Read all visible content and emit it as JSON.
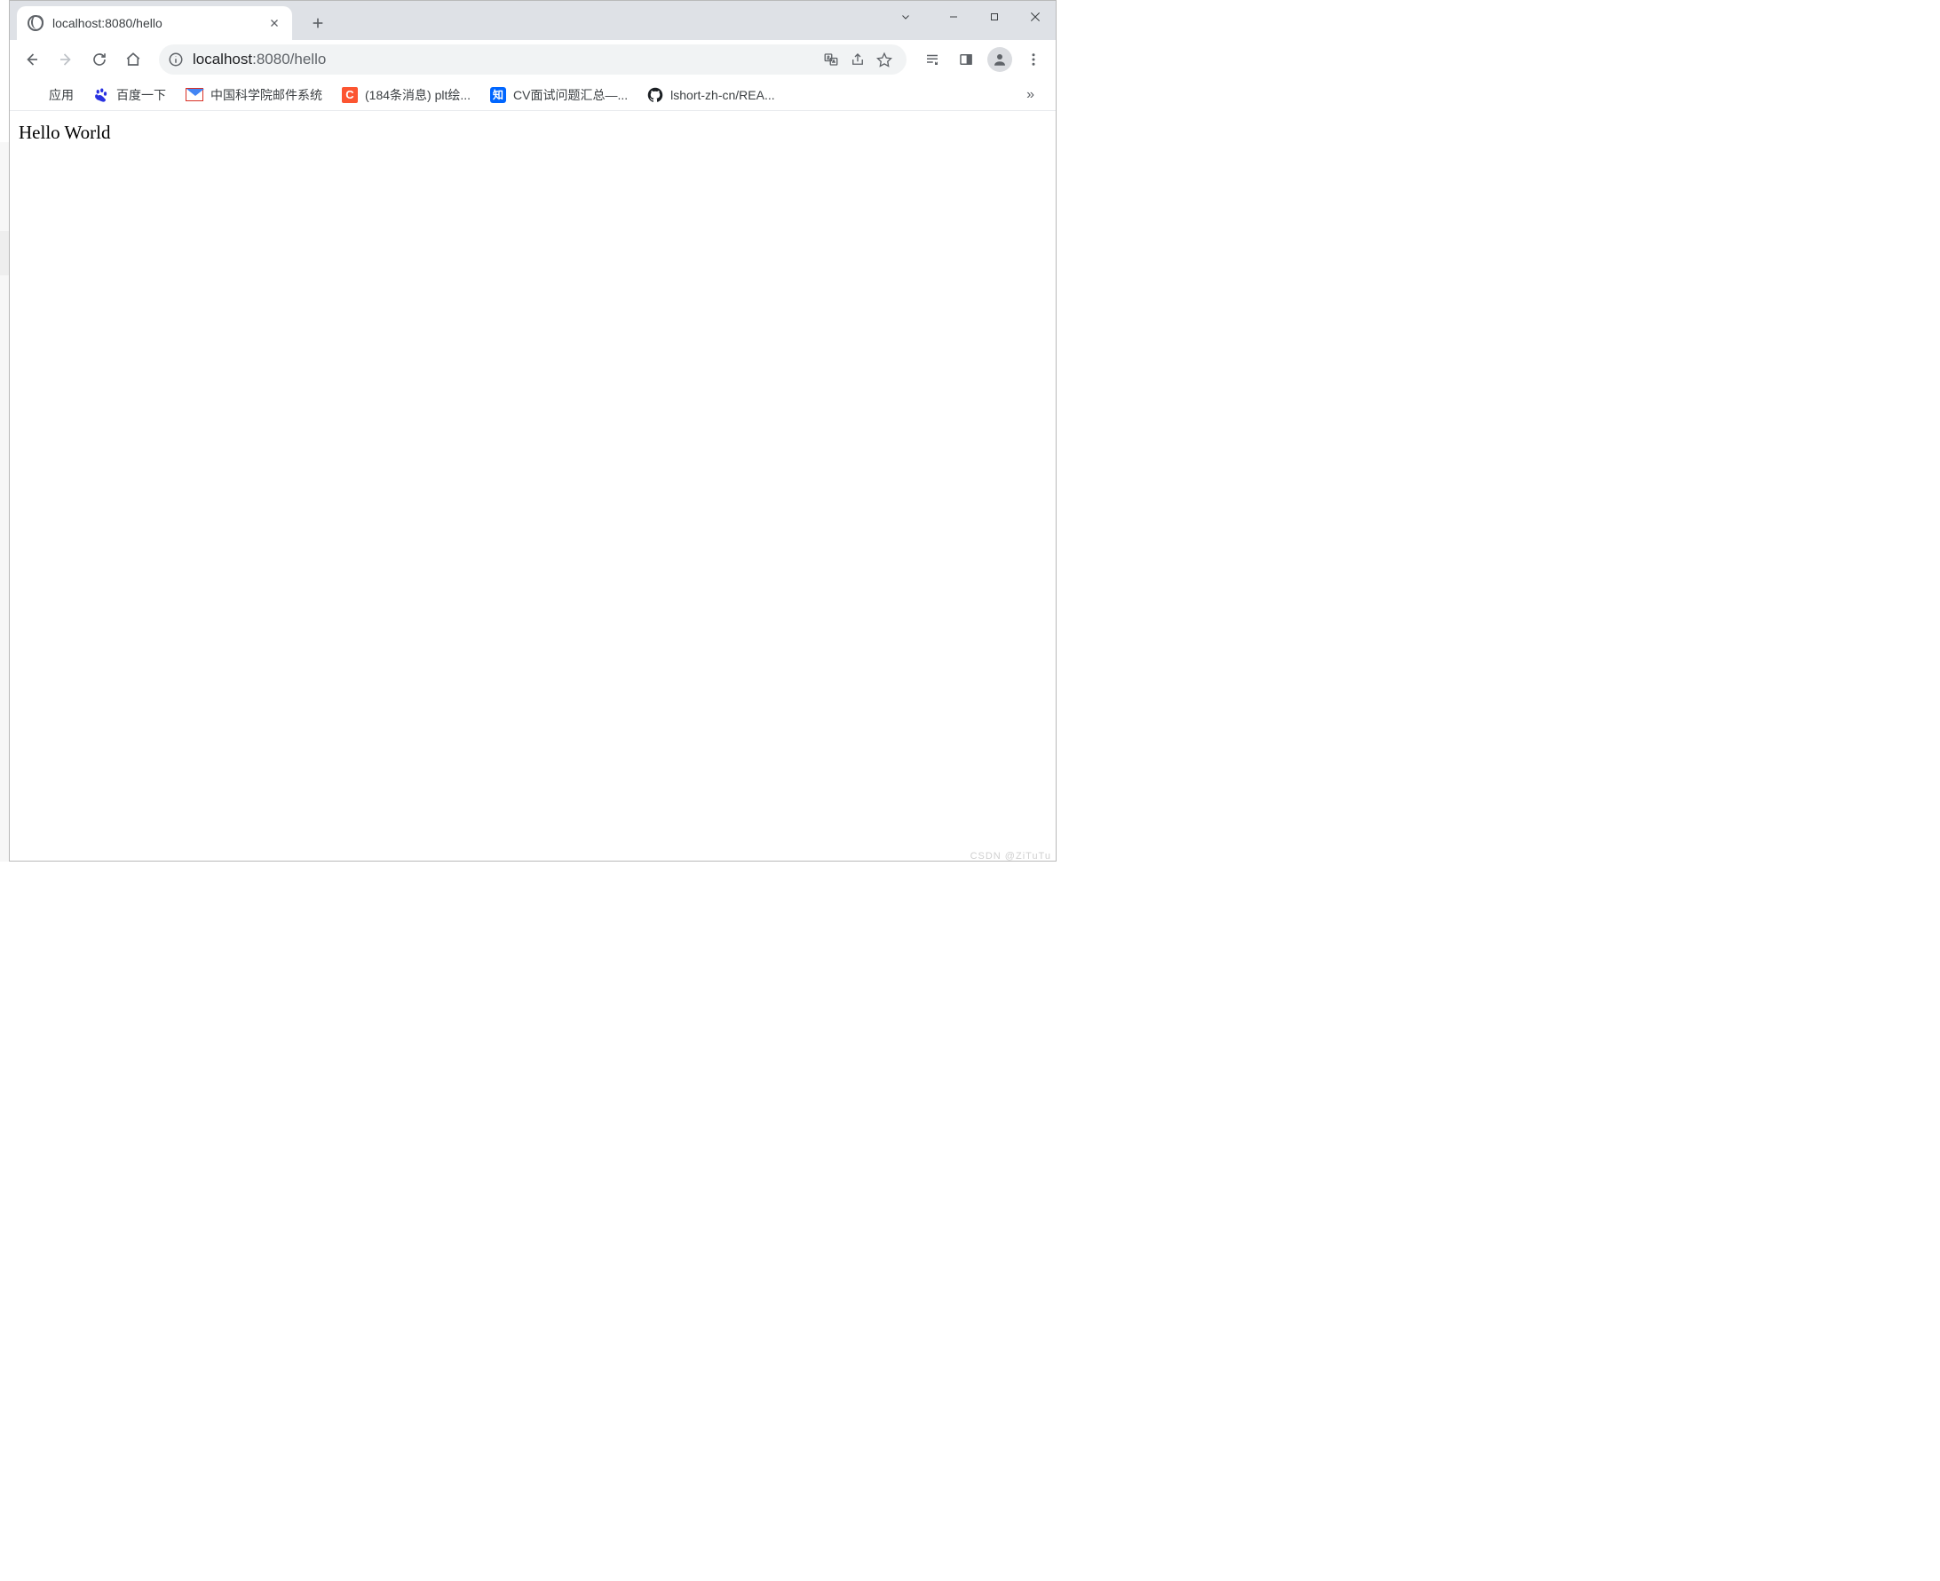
{
  "tab": {
    "title": "localhost:8080/hello"
  },
  "address": {
    "host": "localhost",
    "port": ":8080",
    "path": "/hello"
  },
  "bookmarks": {
    "items": [
      {
        "label": "应用",
        "icon": "apps"
      },
      {
        "label": "百度一下",
        "icon": "baidu"
      },
      {
        "label": "中国科学院邮件系统",
        "icon": "mail"
      },
      {
        "label": "(184条消息) plt绘...",
        "icon": "csdn"
      },
      {
        "label": "CV面试问题汇总—...",
        "icon": "zhi"
      },
      {
        "label": "lshort-zh-cn/REA...",
        "icon": "github"
      }
    ],
    "overflow": "»"
  },
  "page": {
    "body": "Hello World"
  },
  "watermark": "CSDN @ZiTuTu"
}
